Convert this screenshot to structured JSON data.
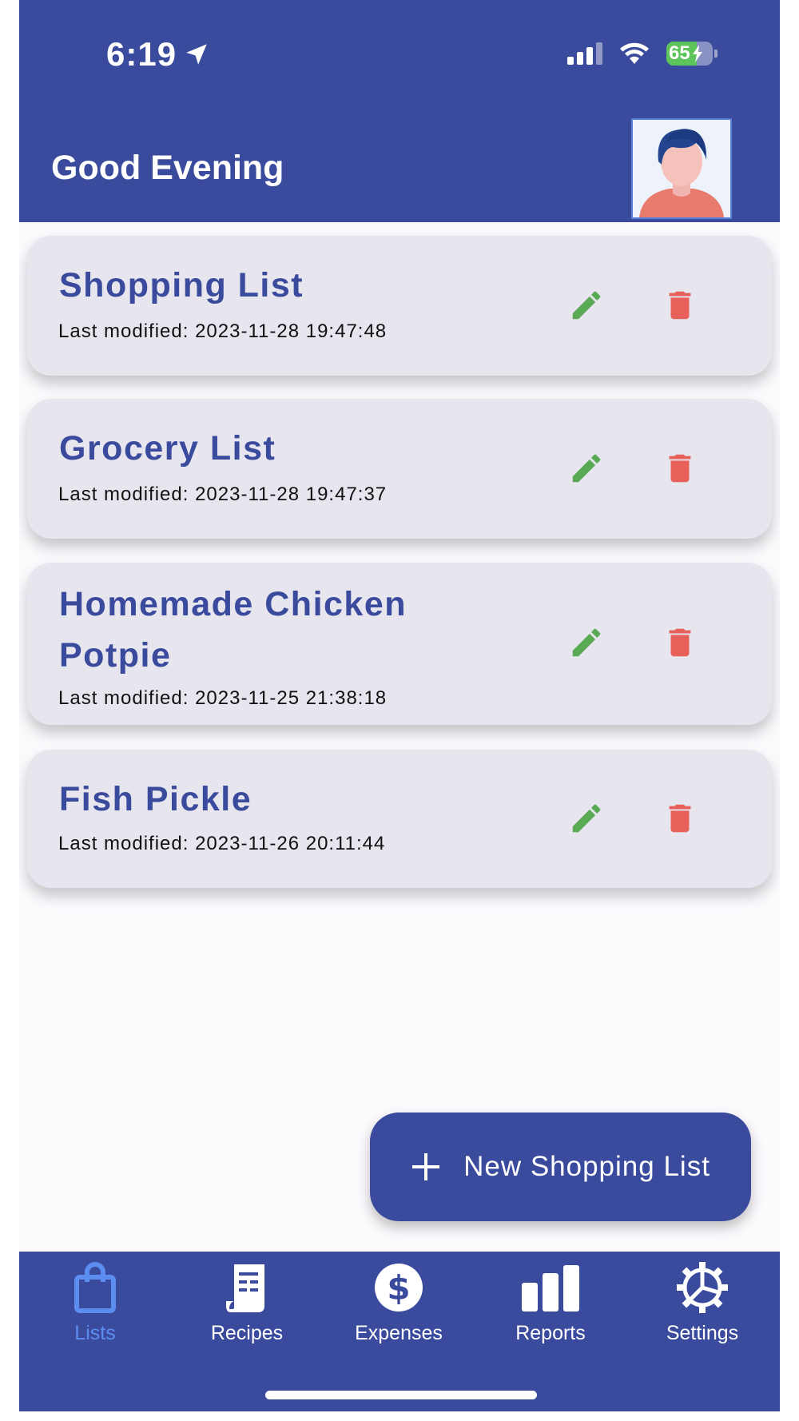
{
  "status": {
    "time": "6:19",
    "battery": "65"
  },
  "header": {
    "greeting": "Good Evening"
  },
  "lists": [
    {
      "title": "Shopping List",
      "modified": "Last modified: 2023-11-28 19:47:48"
    },
    {
      "title": "Grocery List",
      "modified": "Last modified: 2023-11-28 19:47:37"
    },
    {
      "title": "Homemade Chicken Potpie",
      "modified": "Last modified: 2023-11-25 21:38:18"
    },
    {
      "title": "Fish Pickle",
      "modified": "Last modified: 2023-11-26 20:11:44"
    }
  ],
  "fab": {
    "label": "New Shopping List"
  },
  "nav": [
    {
      "label": "Lists",
      "icon": "shopping-bag-icon",
      "active": true
    },
    {
      "label": "Recipes",
      "icon": "recipe-icon"
    },
    {
      "label": "Expenses",
      "icon": "dollar-icon"
    },
    {
      "label": "Reports",
      "icon": "bar-chart-icon"
    },
    {
      "label": "Settings",
      "icon": "gear-icon"
    }
  ],
  "colors": {
    "primary": "#3a4a9c",
    "edit": "#5aa955",
    "delete": "#e8605a",
    "active_nav": "#5b8ef0",
    "card_bg": "#e7e5ee"
  }
}
